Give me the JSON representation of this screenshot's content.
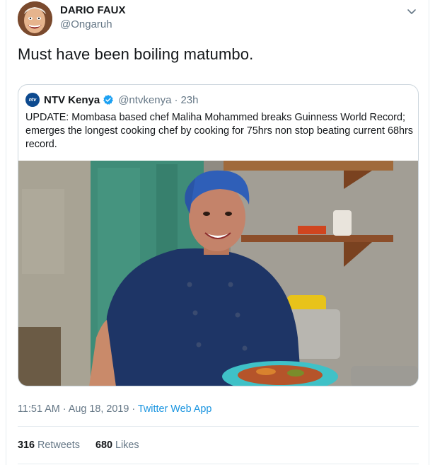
{
  "tweet": {
    "author_name": "DARIO FAUX",
    "author_handle": "@Ongaruh",
    "text": "Must have been boiling matumbo.",
    "timestamp": "11:51 AM · Aug 18, 2019",
    "source_separator": " · ",
    "source": "Twitter Web App",
    "retweets_count": "316",
    "retweets_label": "Retweets",
    "likes_count": "680",
    "likes_label": "Likes"
  },
  "quoted_tweet": {
    "logo_text": "ntv",
    "author_name": "NTV Kenya",
    "verified": true,
    "author_handle": "@ntvkenya",
    "separator": "·",
    "time": "23h",
    "text": "UPDATE: Mombasa based chef Maliha Mohammed breaks Guinness World Record; emerges the longest cooking chef by cooking for 75hrs non stop beating current 68hrs record."
  },
  "icons": {
    "caret": "chevron-down-icon",
    "verified": "verified-badge-icon"
  },
  "colors": {
    "link": "#1b95e0",
    "secondary_text": "#657786",
    "border": "#ccd6dd",
    "verified": "#1da1f2"
  }
}
